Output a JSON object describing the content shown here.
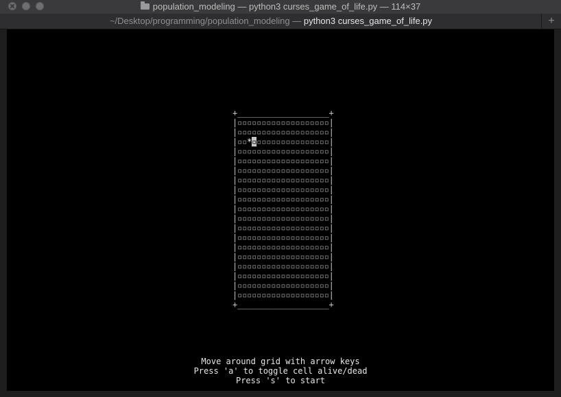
{
  "window": {
    "title": "population_modeling — python3 curses_game_of_life.py — 114×37"
  },
  "tab": {
    "path": "~/Desktop/programming/population_modeling",
    "separator": " — ",
    "process": "python3 curses_game_of_life.py",
    "new_tab_label": "+"
  },
  "grid": {
    "top_border": "+___________________+",
    "bottom_border": "+___________________+",
    "rows_count": 19,
    "cols_count": 19,
    "dead_glyph": "▫",
    "cursor_row": 2,
    "cursor_col": 3,
    "alive_cells": [
      [
        2,
        2
      ]
    ],
    "alive_glyph": "*"
  },
  "help": {
    "line1": "Move around grid with arrow keys",
    "line2": "Press 'a' to toggle cell alive/dead",
    "line3": "Press 's' to start"
  },
  "colors": {
    "terminal_bg": "#000000",
    "text": "#e6e6e6",
    "cursor": "#c7c7c7"
  }
}
